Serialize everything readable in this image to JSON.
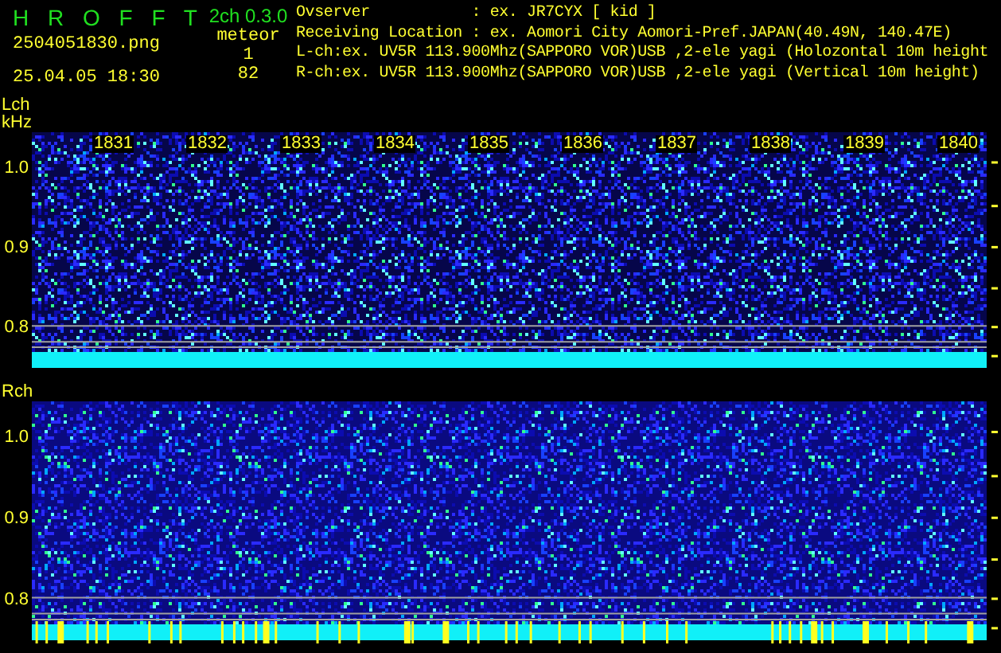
{
  "app": {
    "title": "H R O F F T",
    "version": "2ch 0.3.0"
  },
  "file": {
    "name": "2504051830.png",
    "datetime": "25.04.05 18:30"
  },
  "meteor": {
    "label": "meteor",
    "counts": [
      "1",
      "82"
    ]
  },
  "info": [
    "Ovserver           : ex. JR7CYX [ kid ]",
    "Receiving Location : ex. Aomori City Aomori-Pref.JAPAN(40.49N, 140.47E)",
    "L-ch:ex. UV5R 113.900Mhz(SAPPORO VOR)USB ,2-ele yagi (Holozontal 10m height",
    "R-ch:ex. UV5R 113.900Mhz(SAPPORO VOR)USB ,2-ele yagi (Vertical 10m height)"
  ],
  "panels": [
    {
      "channel": "Lch",
      "unit": "kHz",
      "time_labels": [
        "1831",
        "1832",
        "1833",
        "1834",
        "1835",
        "1836",
        "1837",
        "1838",
        "1839",
        "1840"
      ],
      "y_ticks": [
        "1.0",
        "0.9",
        "0.8"
      ]
    },
    {
      "channel": "Rch",
      "y_ticks": [
        "1.0",
        "0.9",
        "0.8"
      ]
    }
  ]
}
